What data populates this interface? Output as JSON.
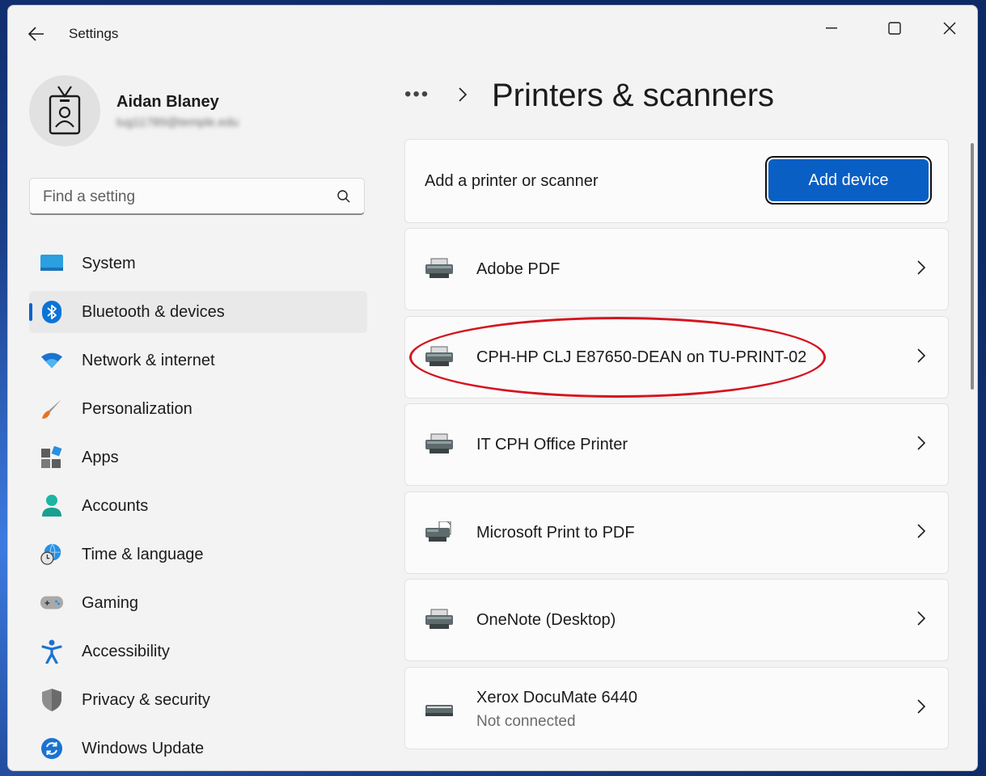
{
  "window": {
    "title": "Settings"
  },
  "user": {
    "name": "Aidan Blaney",
    "email": "tug11789@temple.edu"
  },
  "search": {
    "placeholder": "Find a setting"
  },
  "sidebar": {
    "items": [
      {
        "label": "System",
        "icon": "monitor-icon"
      },
      {
        "label": "Bluetooth & devices",
        "icon": "bluetooth-icon",
        "active": true
      },
      {
        "label": "Network & internet",
        "icon": "wifi-icon"
      },
      {
        "label": "Personalization",
        "icon": "paintbrush-icon"
      },
      {
        "label": "Apps",
        "icon": "apps-icon"
      },
      {
        "label": "Accounts",
        "icon": "person-icon"
      },
      {
        "label": "Time & language",
        "icon": "globe-clock-icon"
      },
      {
        "label": "Gaming",
        "icon": "gamepad-icon"
      },
      {
        "label": "Accessibility",
        "icon": "accessibility-icon"
      },
      {
        "label": "Privacy & security",
        "icon": "shield-icon"
      },
      {
        "label": "Windows Update",
        "icon": "update-icon"
      }
    ]
  },
  "breadcrumb": {
    "more": "•••",
    "title": "Printers & scanners"
  },
  "add_section": {
    "label": "Add a printer or scanner",
    "button": "Add device"
  },
  "printers": [
    {
      "name": "Adobe PDF",
      "icon": "printer-icon"
    },
    {
      "name": "CPH-HP CLJ E87650-DEAN on TU-PRINT-02",
      "icon": "printer-icon",
      "highlighted": true
    },
    {
      "name": "IT CPH Office Printer",
      "icon": "printer-icon"
    },
    {
      "name": "Microsoft Print to PDF",
      "icon": "printer-pdf-icon"
    },
    {
      "name": "OneNote (Desktop)",
      "icon": "printer-icon"
    },
    {
      "name": "Xerox DocuMate 6440",
      "status": "Not connected",
      "icon": "scanner-icon"
    }
  ],
  "colors": {
    "accent": "#0a5fc4",
    "highlight_circle": "#d4141f"
  }
}
